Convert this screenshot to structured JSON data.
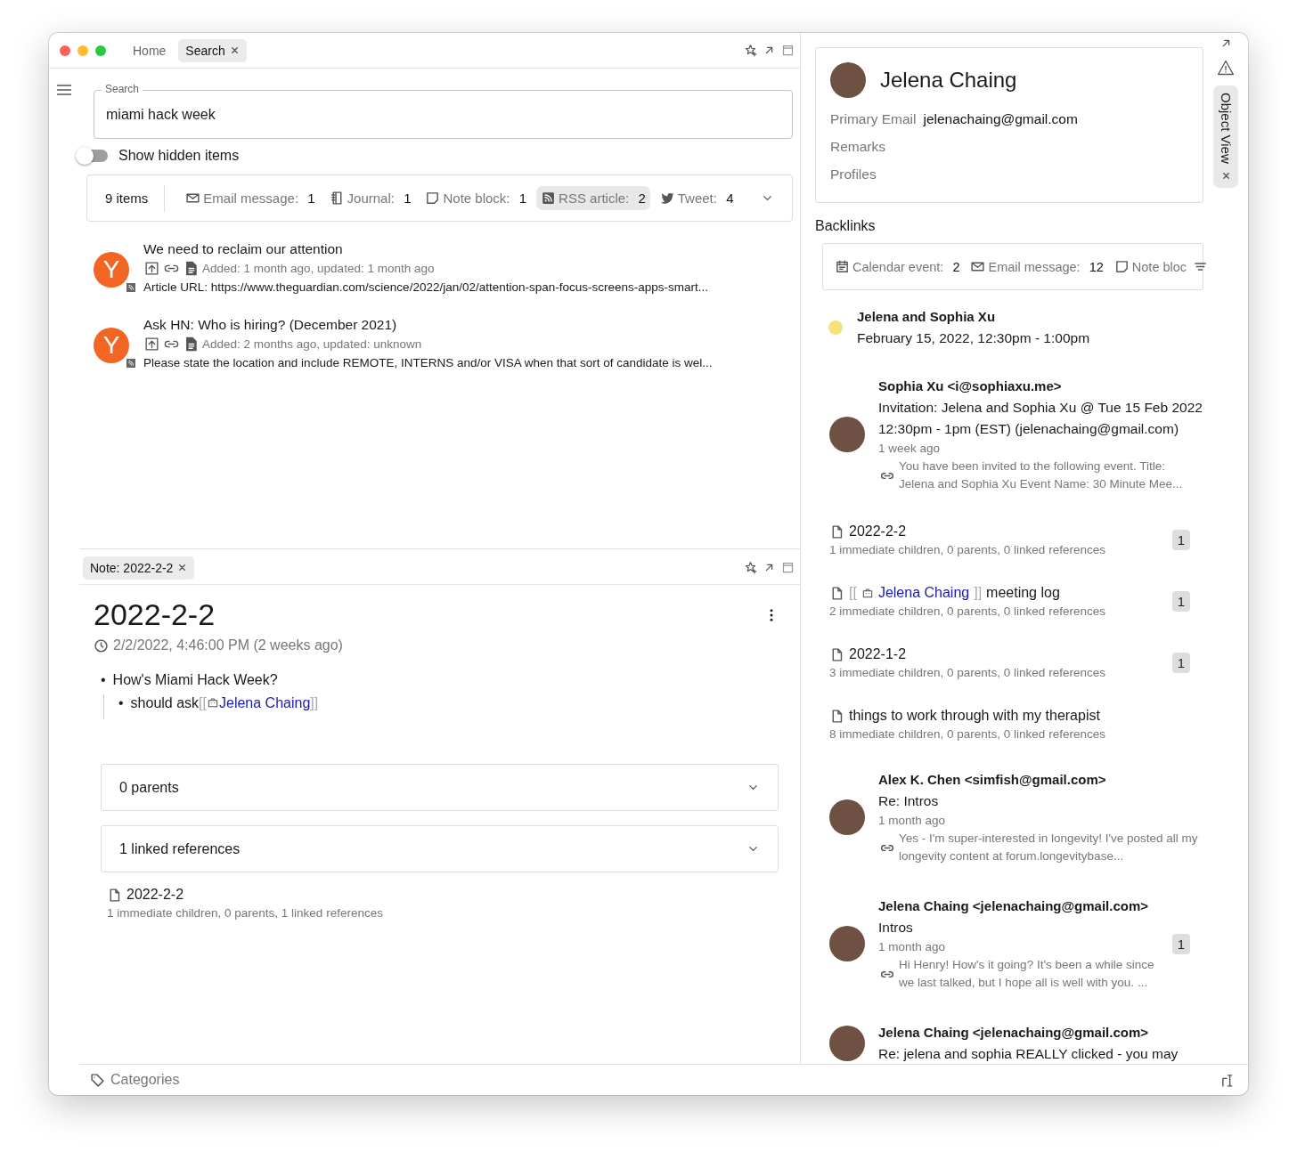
{
  "tabs": [
    {
      "label": "Home",
      "selected": false
    },
    {
      "label": "Search",
      "selected": true
    }
  ],
  "search": {
    "label": "Search",
    "value": "miami hack week"
  },
  "show_hidden": {
    "label": "Show hidden items",
    "on": false
  },
  "filter": {
    "count": "9 items",
    "chips": [
      {
        "kind": "email",
        "label": "Email message:",
        "count": "1",
        "selected": false
      },
      {
        "kind": "journal",
        "label": "Journal:",
        "count": "1",
        "selected": false
      },
      {
        "kind": "note",
        "label": "Note block:",
        "count": "1",
        "selected": false
      },
      {
        "kind": "rss",
        "label": "RSS article:",
        "count": "2",
        "selected": true
      },
      {
        "kind": "tweet",
        "label": "Tweet:",
        "count": "4",
        "selected": false
      }
    ]
  },
  "results": [
    {
      "avatar": "Y",
      "title": "We need to reclaim our attention",
      "meta": "Added: 1 month ago, updated: 1 month ago",
      "snippet": "Article URL: https://www.theguardian.com/science/2022/jan/02/attention-span-focus-screens-apps-smart..."
    },
    {
      "avatar": "Y",
      "title": "Ask HN: Who is hiring? (December 2021)",
      "meta": "Added: 2 months ago, updated: unknown",
      "snippet": "Please state the location and include REMOTE, INTERNS and/or VISA when that sort of candidate is wel..."
    }
  ],
  "note": {
    "tab": "Note: 2022-2-2",
    "title": "2022-2-2",
    "date": "2/2/2022, 4:46:00 PM (2 weeks ago)",
    "bullets": [
      {
        "marker": "•",
        "text": "How's Miami Hack Week?",
        "children": [
          {
            "marker": "•",
            "text": "should ask",
            "open": "[[",
            "link": "Jelena Chaing",
            "close": "]]"
          }
        ]
      }
    ],
    "sections": [
      {
        "label": "0 parents"
      },
      {
        "label": "1 linked references"
      }
    ],
    "references": [
      {
        "title": "2022-2-2",
        "meta": "1 immediate children, 0 parents, 1 linked references"
      }
    ]
  },
  "footer": {
    "label": "Categories"
  },
  "person": {
    "name": "Jelena Chaing",
    "fields": [
      {
        "label": "Primary Email",
        "value": "jelenachaing@gmail.com"
      },
      {
        "label": "Remarks"
      },
      {
        "label": "Profiles"
      }
    ]
  },
  "side_tab": {
    "label": "Object View"
  },
  "backlinks": {
    "title": "Backlinks",
    "chips": [
      {
        "kind": "calendar",
        "label": "Calendar event:",
        "count": "2"
      },
      {
        "kind": "email",
        "label": "Email message:",
        "count": "12"
      },
      {
        "kind": "note",
        "label": "Note bloc"
      }
    ],
    "items": [
      {
        "kind": "event",
        "color": "#f5e27c",
        "title": "Jelena and Sophia Xu",
        "time": "February 15, 2022, 12:30pm - 1:00pm"
      },
      {
        "kind": "email",
        "from": "Sophia Xu <i@sophiaxu.me>",
        "subject": "Invitation: Jelena and Sophia Xu @ Tue 15 Feb 2022 12:30pm - 1pm (EST) (jelenachaing@gmail.com)",
        "time": "1 week ago",
        "snippet": "You have been invited to the following event. Title: Jelena and Sophia Xu Event Name: 30 Minute Mee..."
      },
      {
        "kind": "note",
        "title": "2022-2-2",
        "meta": "1 immediate children, 0 parents, 0 linked references",
        "count": "1"
      },
      {
        "kind": "note",
        "open": "[[",
        "link": "Jelena Chaing",
        "close": "]]",
        "title": "meeting log",
        "meta": "2 immediate children, 0 parents, 0 linked references",
        "count": "1"
      },
      {
        "kind": "note",
        "title": "2022-1-2",
        "meta": "3 immediate children, 0 parents, 0 linked references",
        "count": "1"
      },
      {
        "kind": "note",
        "title": "things to work through with my therapist",
        "meta": "8 immediate children, 0 parents, 0 linked references"
      },
      {
        "kind": "email",
        "from": "Alex K. Chen <simfish@gmail.com>",
        "subject": "Re: Intros",
        "time": "1 month ago",
        "snippet": "Yes - I'm super-interested in longevity! I've posted all my longevity content at forum.longevitybase..."
      },
      {
        "kind": "email",
        "from": "Jelena Chaing <jelenachaing@gmail.com>",
        "subject": "Intros",
        "time": "1 month ago",
        "snippet": "Hi Henry! How's it going? It's been a while since we last talked, but I hope all is well with you. ...",
        "count": "1"
      },
      {
        "kind": "email",
        "from": "Jelena Chaing <jelenachaing@gmail.com>",
        "subject": "Re: jelena and sophia REALLY clicked - you may"
      }
    ]
  }
}
